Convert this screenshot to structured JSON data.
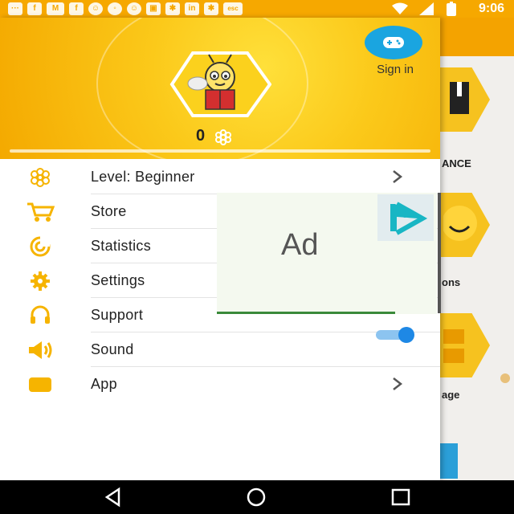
{
  "status_bar": {
    "time": "9:06",
    "icons": [
      "message-icon",
      "facebook-icon",
      "gmail-icon",
      "facebook-icon",
      "snapchat-icon",
      "messenger-icon",
      "snapchat-icon",
      "photo-icon",
      "reddit-icon",
      "linkedin-icon",
      "reddit-icon",
      "esc-icon",
      "wifi-icon",
      "signal-icon",
      "battery-icon"
    ]
  },
  "drawer": {
    "sign_in_label": "Sign in",
    "score": "0",
    "menu": [
      {
        "label": "Level: Beginner",
        "icon": "flower-icon",
        "chevron": true
      },
      {
        "label": "Store",
        "icon": "cart-icon"
      },
      {
        "label": "Statistics",
        "icon": "radar-icon"
      },
      {
        "label": "Settings",
        "icon": "gear-icon"
      },
      {
        "label": "Support",
        "icon": "headset-icon"
      },
      {
        "label": "Sound",
        "icon": "speaker-icon",
        "toggle_on": true
      },
      {
        "label": "App",
        "icon": "app-icon",
        "chevron": true
      }
    ]
  },
  "ad": {
    "text": "Ad"
  },
  "background": {
    "labels": [
      "ANCE",
      "ons",
      "age"
    ]
  },
  "colors": {
    "accent": "#f6b400",
    "status_bar": "#f6a800",
    "sign_in": "#1aa5e0",
    "toggle": "#1e88e5"
  }
}
